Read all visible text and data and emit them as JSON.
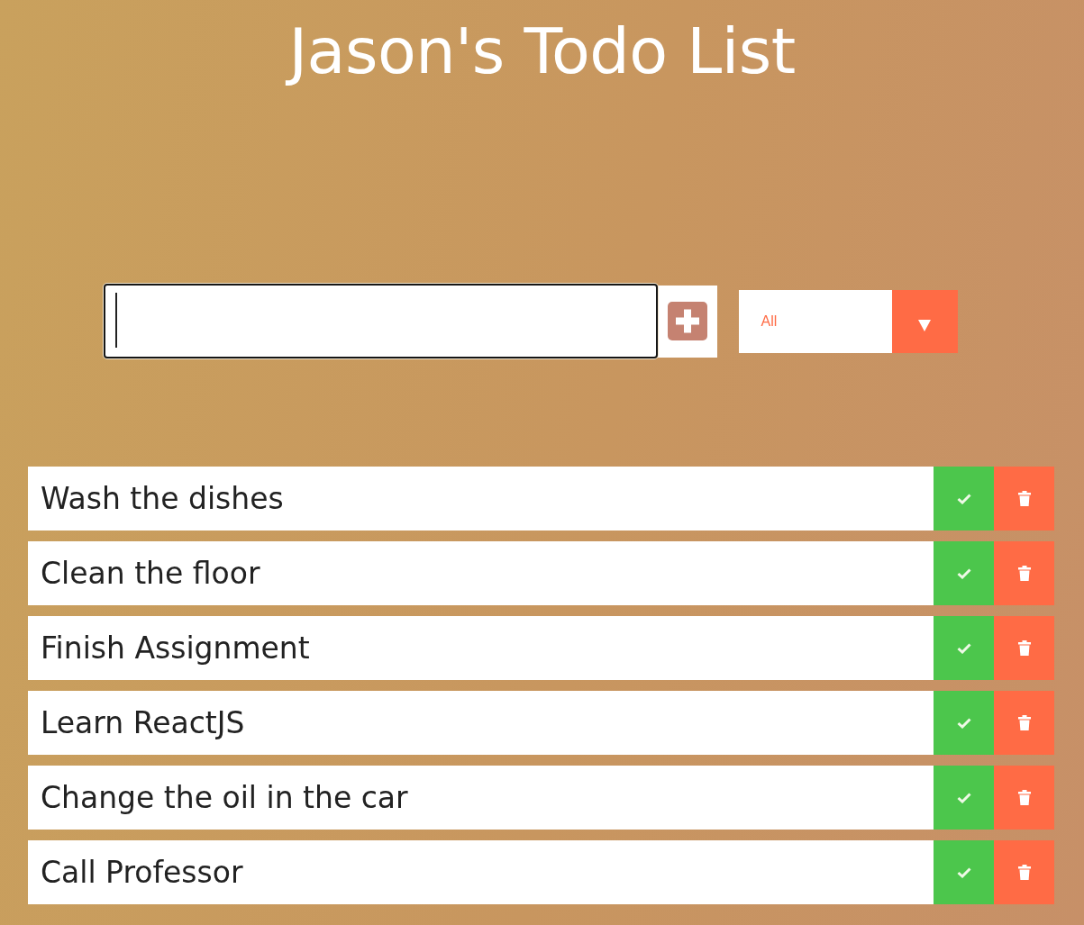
{
  "title": "Jason's Todo List",
  "new_todo": {
    "focused": true
  },
  "filter": {
    "value": "All"
  },
  "todos": [
    {
      "text": "Wash the dishes"
    },
    {
      "text": "Clean the floor"
    },
    {
      "text": "Finish Assignment"
    },
    {
      "text": "Learn ReactJS"
    },
    {
      "text": "Change the oil in the car"
    },
    {
      "text": "Call Professor"
    }
  ]
}
